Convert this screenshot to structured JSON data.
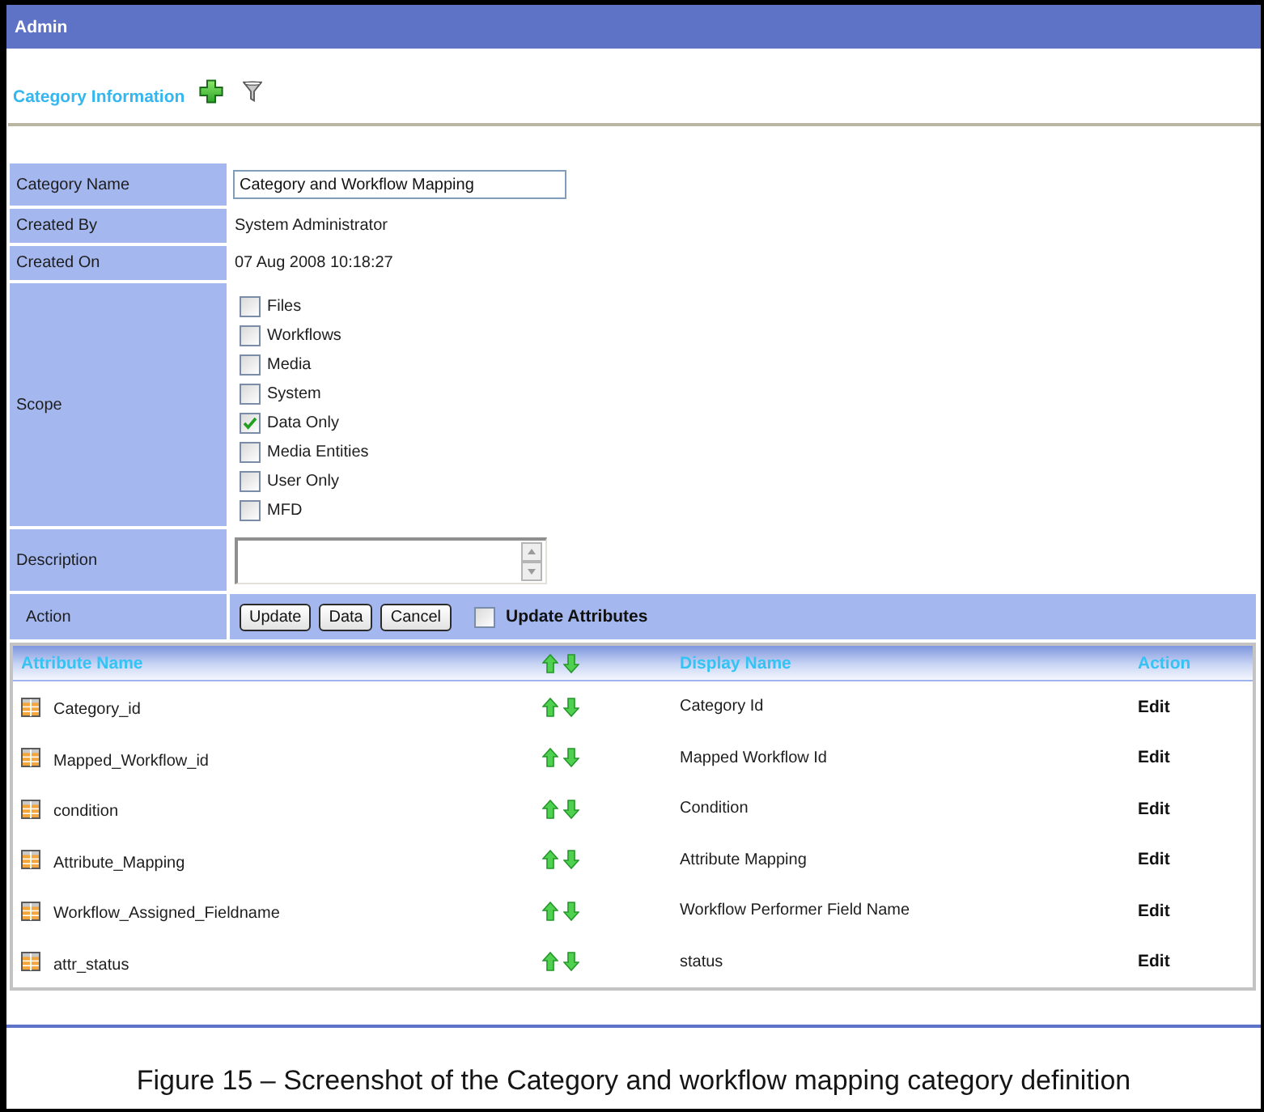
{
  "header": {
    "title": "Admin"
  },
  "section": {
    "title": "Category Information"
  },
  "form": {
    "fields": [
      {
        "kind": "input",
        "label": "Category Name",
        "value": "Category and Workflow Mapping"
      },
      {
        "kind": "text",
        "label": "Created By",
        "value": "System Administrator"
      },
      {
        "kind": "text",
        "label": "Created On",
        "value": "07 Aug 2008 10:18:27"
      },
      {
        "kind": "checklist",
        "label": "Scope",
        "options": [
          {
            "label": "Files",
            "checked": false
          },
          {
            "label": "Workflows",
            "checked": false
          },
          {
            "label": "Media",
            "checked": false
          },
          {
            "label": "System",
            "checked": false
          },
          {
            "label": "Data Only",
            "checked": true
          },
          {
            "label": "Media Entities",
            "checked": false
          },
          {
            "label": "User Only",
            "checked": false
          },
          {
            "label": "MFD",
            "checked": false
          }
        ]
      },
      {
        "kind": "textarea",
        "label": "Description"
      }
    ]
  },
  "action": {
    "label": "Action",
    "buttons": [
      "Update",
      "Data",
      "Cancel"
    ],
    "option": {
      "label": "Update Attributes",
      "checked": false
    }
  },
  "table": {
    "columns": [
      "Attribute Name",
      "Display Name",
      "Action"
    ],
    "rows": [
      {
        "attribute": "Category_id",
        "display": "Category Id",
        "action": "Edit"
      },
      {
        "attribute": "Mapped_Workflow_id",
        "display": "Mapped Workflow Id",
        "action": "Edit"
      },
      {
        "attribute": "condition",
        "display": "Condition",
        "action": "Edit"
      },
      {
        "attribute": "Attribute_Mapping",
        "display": "Attribute Mapping",
        "action": "Edit"
      },
      {
        "attribute": "Workflow_Assigned_Fieldname",
        "display": "Workflow Performer Field Name",
        "action": "Edit"
      },
      {
        "attribute": "attr_status",
        "display": "status",
        "action": "Edit"
      }
    ]
  },
  "caption": "Figure 15 – Screenshot of the Category and workflow mapping category definition"
}
